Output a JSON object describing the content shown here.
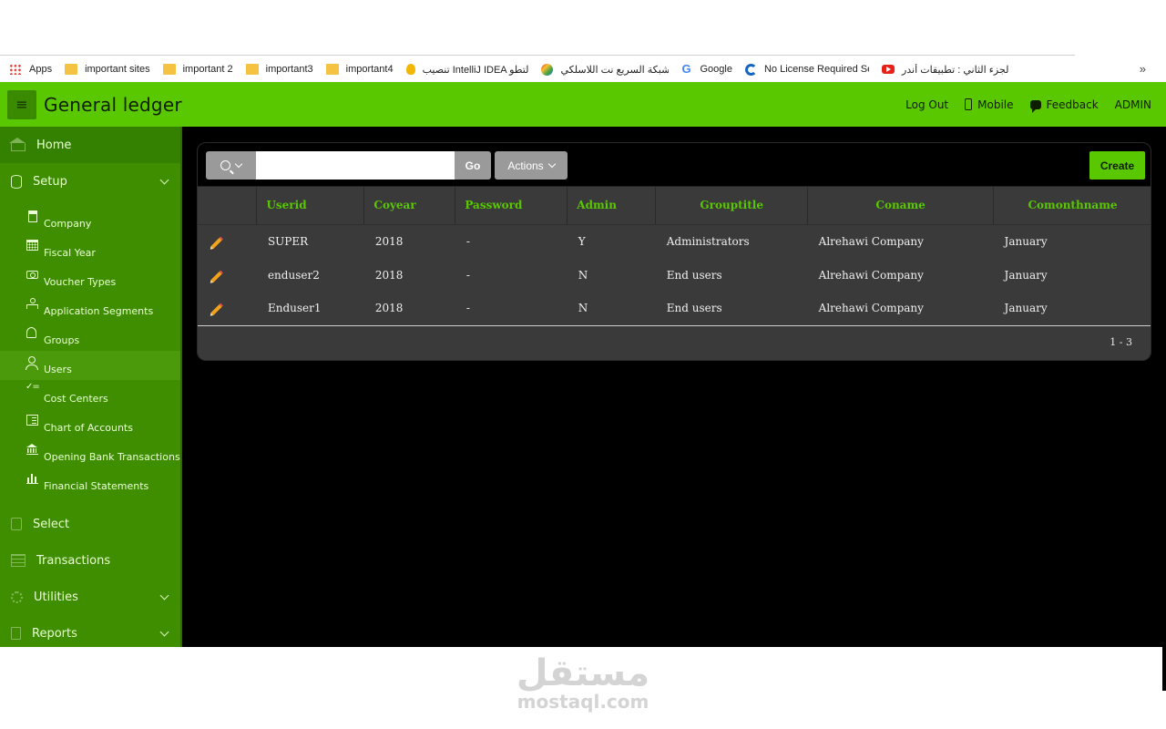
{
  "bookmarks": {
    "items": [
      {
        "label": "Apps",
        "icon": "apps-grid-icon"
      },
      {
        "label": "important sites",
        "icon": "folder-icon"
      },
      {
        "label": "important 2",
        "icon": "folder-icon"
      },
      {
        "label": "important3",
        "icon": "folder-icon"
      },
      {
        "label": "important4",
        "icon": "folder-icon"
      },
      {
        "label": "تنصيب IntelliJ IDEA لتطو",
        "icon": "lightbulb-icon"
      },
      {
        "label": "شبكة السريع نت اللاسلكي",
        "icon": "globe-icon"
      },
      {
        "label": "Google",
        "icon": "google-icon"
      },
      {
        "label": "No License Required Se",
        "icon": "c-logo-icon"
      },
      {
        "label": "الجزء الثاني : تطبيقات أندر",
        "icon": "youtube-icon"
      }
    ],
    "more": "»"
  },
  "header": {
    "menu_icon": "≡",
    "title": "General ledger",
    "nav": {
      "logout": "Log Out",
      "mobile": "Mobile",
      "feedback": "Feedback",
      "user": "ADMIN"
    }
  },
  "sidebar": {
    "home": "Home",
    "setup": "Setup",
    "setup_items": [
      "Company",
      "Fiscal Year",
      "Voucher Types",
      "Application Segments",
      "Groups",
      "Users",
      "Cost Centers",
      "Chart of Accounts",
      "Opening Bank Transactions",
      "Financial Statements"
    ],
    "active_item": "Users",
    "select": "Select",
    "transactions": "Transactions",
    "utilities": "Utilities",
    "reports": "Reports"
  },
  "toolbar": {
    "search_value": "",
    "go": "Go",
    "actions": "Actions",
    "create": "Create"
  },
  "grid": {
    "columns": [
      "Userid",
      "Coyear",
      "Password",
      "Admin",
      "Grouptitle",
      "Coname",
      "Comonthname"
    ],
    "rows": [
      [
        "SUPER",
        "2018",
        "-",
        "Y",
        "Administrators",
        "Alrehawi Company",
        "January"
      ],
      [
        "enduser2",
        "2018",
        "-",
        "N",
        "End users",
        "Alrehawi Company",
        "January"
      ],
      [
        "Enduser1",
        "2018",
        "-",
        "N",
        "End users",
        "Alrehawi Company",
        "January"
      ]
    ],
    "pagination": "1 - 3"
  },
  "watermark": {
    "arabic": "مستقل",
    "latin": "mostaql.com"
  },
  "colors": {
    "brand_green": "#5ac800",
    "sidebar_green": "#3e8e00",
    "column_header": "#5ac800",
    "edit_icon": "#f3a21b"
  }
}
